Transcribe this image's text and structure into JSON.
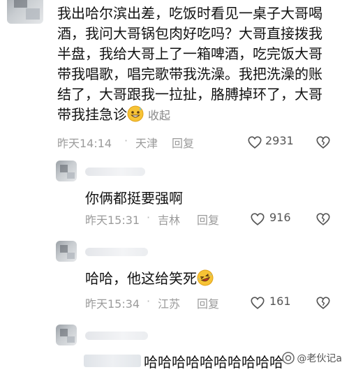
{
  "comments": [
    {
      "text": "我出哈尔滨出差，吃饭时看见一桌子大哥喝酒，我问大哥锅包肉好吃吗？大哥直接拨我半盘，我给大哥上了一箱啤酒，吃完饭大哥带我唱歌，唱完歌带我洗澡。我把洗澡的账结了，大哥跟我一拉扯，胳膊掉环了，大哥带我挂急诊",
      "emoji": "grinning-sweat-emoji",
      "fold_label": "收起",
      "time": "昨天14:14",
      "location": "天津",
      "reply_label": "回复",
      "likes": "2931"
    }
  ],
  "replies": [
    {
      "text": "你俩都挺要强啊",
      "time": "昨天15:31",
      "location": "吉林",
      "reply_label": "回复",
      "likes": "916"
    },
    {
      "text": "哈哈，他这给笑死",
      "emoji": "rolling-laughing-emoji",
      "time": "昨天15:34",
      "location": "江苏",
      "reply_label": "回复",
      "likes": "161"
    },
    {
      "text": "哈哈哈哈哈哈哈哈哈哈"
    }
  ],
  "meta_separator": "·",
  "watermark": "@老伙记a",
  "colors": {
    "text": "#111111",
    "meta": "#9b9b9b",
    "background": "#ffffff"
  }
}
